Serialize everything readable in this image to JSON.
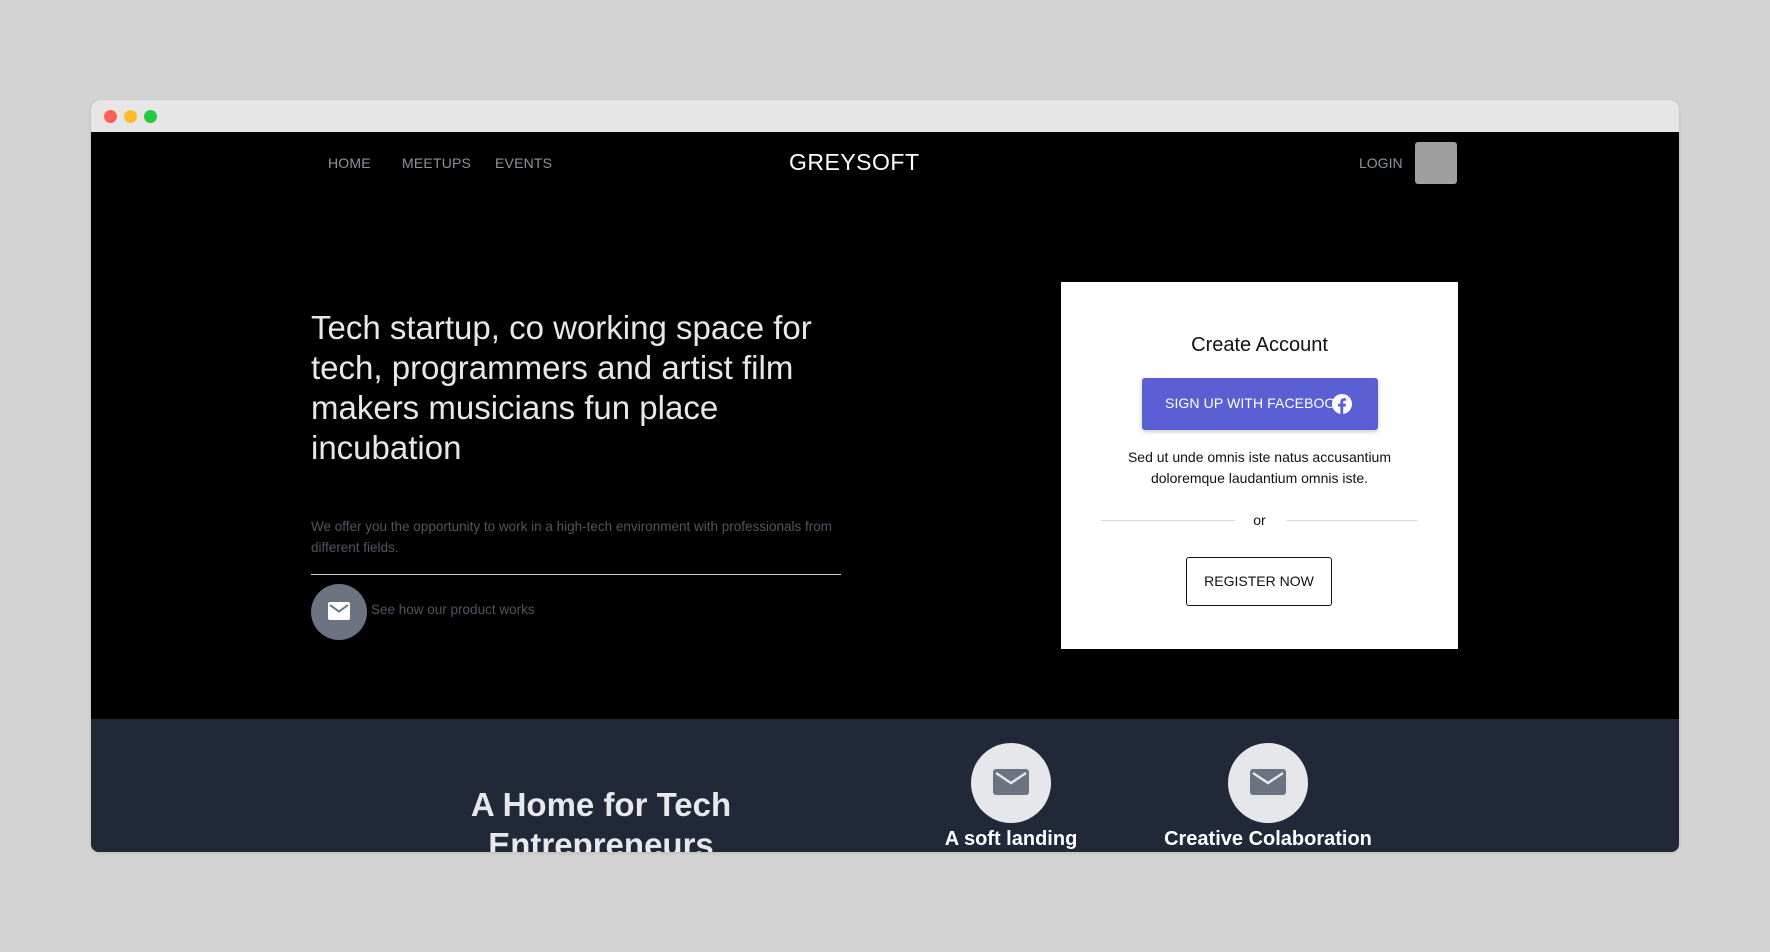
{
  "nav": {
    "links": [
      "HOME",
      "MEETUPS",
      "EVENTS"
    ],
    "brand": "GREYSOFT",
    "login": "LOGIN"
  },
  "hero": {
    "headline": "Tech startup, co working space for tech, programmers and artist film makers musicians fun place incubation",
    "subtext": "We offer you the opportunity to work in a high-tech environment with professionals from different fields.",
    "cta_label": "See how our product works",
    "cta_icon": "mail-icon"
  },
  "signup_card": {
    "title": "Create Account",
    "facebook_button": "SIGN UP WITH FACEBOOK",
    "facebook_icon": "facebook-icon",
    "description": "Sed ut unde omnis iste natus accusantium doloremque laudantium omnis iste.",
    "divider_text": "or",
    "register_button": "REGISTER NOW"
  },
  "features": {
    "heading": "A Home for Tech Entrepreneurs",
    "items": [
      {
        "title": "A soft landing",
        "icon": "mail-icon"
      },
      {
        "title": "Creative Colaboration",
        "icon": "mail-icon"
      }
    ]
  },
  "colors": {
    "hero_bg": "#000000",
    "facebook_button": "#5a5fd3",
    "features_bg": "#212938",
    "muted_text": "#4f5560"
  }
}
